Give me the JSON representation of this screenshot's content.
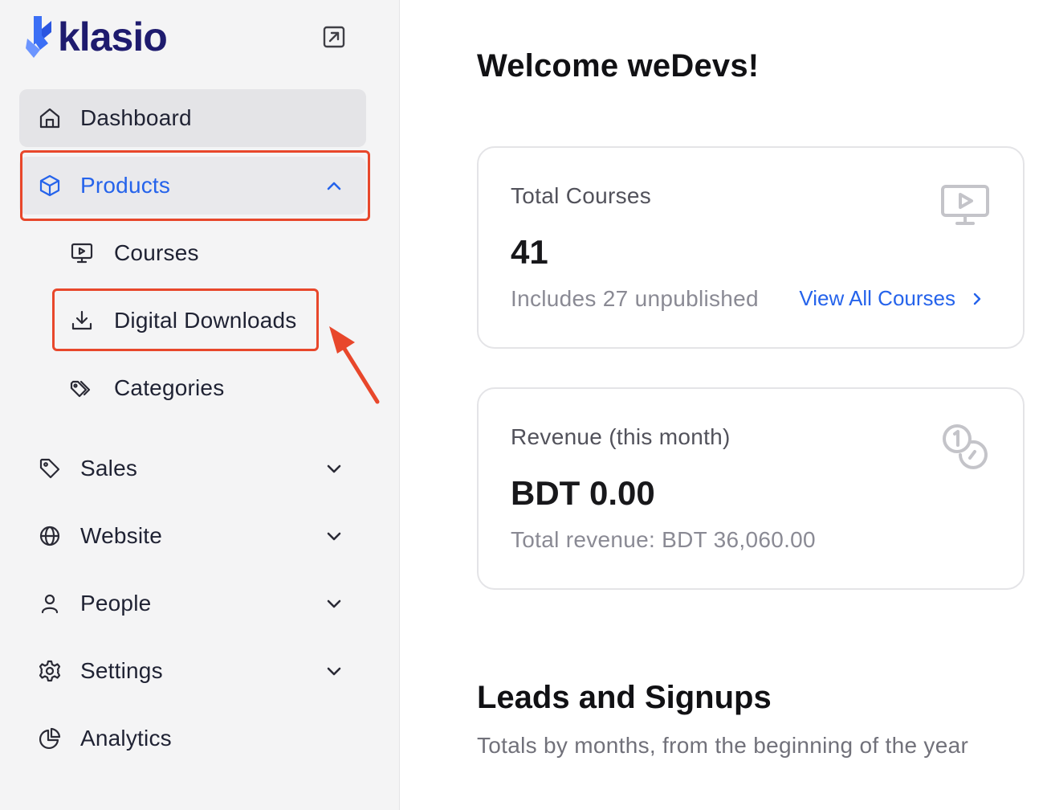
{
  "brand": {
    "name": "klasio",
    "color": "#1e1b6e",
    "accent": "#3b6ff5"
  },
  "sidebar": {
    "items": [
      {
        "label": "Dashboard",
        "icon": "home-icon"
      },
      {
        "label": "Products",
        "icon": "cube-icon",
        "expanded": true
      },
      {
        "label": "Sales",
        "icon": "tag-icon"
      },
      {
        "label": "Website",
        "icon": "globe-icon"
      },
      {
        "label": "People",
        "icon": "user-icon"
      },
      {
        "label": "Settings",
        "icon": "gear-icon"
      },
      {
        "label": "Analytics",
        "icon": "pie-chart-icon"
      }
    ],
    "products_sub": [
      {
        "label": "Courses",
        "icon": "monitor-play-icon"
      },
      {
        "label": "Digital Downloads",
        "icon": "download-icon"
      },
      {
        "label": "Categories",
        "icon": "tags-icon"
      }
    ]
  },
  "main": {
    "title": "Welcome weDevs!",
    "cards": [
      {
        "label": "Total Courses",
        "value": "41",
        "sub": "Includes 27 unpublished",
        "link": "View All Courses",
        "icon": "monitor-play-icon"
      },
      {
        "label": "Revenue (this month)",
        "value": "BDT 0.00",
        "sub": "Total revenue: BDT 36,060.00",
        "icon": "coins-icon"
      }
    ],
    "leads": {
      "title": "Leads and Signups",
      "subtitle": "Totals by months, from the beginning of the year"
    }
  },
  "annotation": {
    "highlight_color": "#e8472b"
  }
}
